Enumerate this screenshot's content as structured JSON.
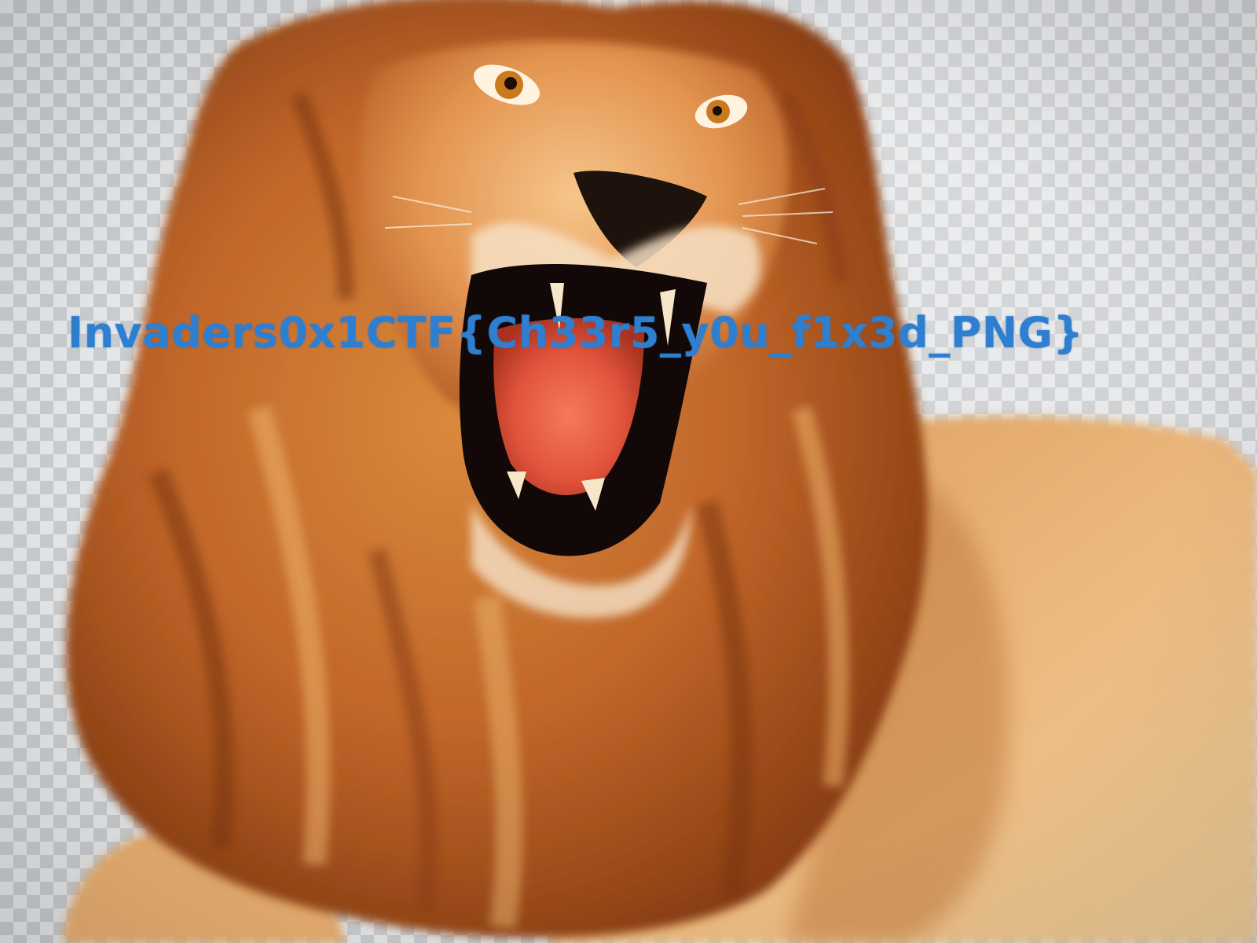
{
  "photo": {
    "subject": "lion-icon",
    "background_pattern": "transparency-checkerboard",
    "colors": {
      "checker_light": "#e4e6e8",
      "checker_dark": "#c9cccf",
      "mane_dark": "#8a3e12",
      "mane_mid": "#c8702a",
      "mane_light": "#e8a95a",
      "fur": "#e9b77a",
      "mouth_dark": "#140a0a",
      "tongue": "#f0624a",
      "text_blue": "#2f7fd0"
    }
  },
  "overlay": {
    "flag": "Invaders0x1CTF{Ch33r5_y0u_f1x3d_PNG}"
  }
}
